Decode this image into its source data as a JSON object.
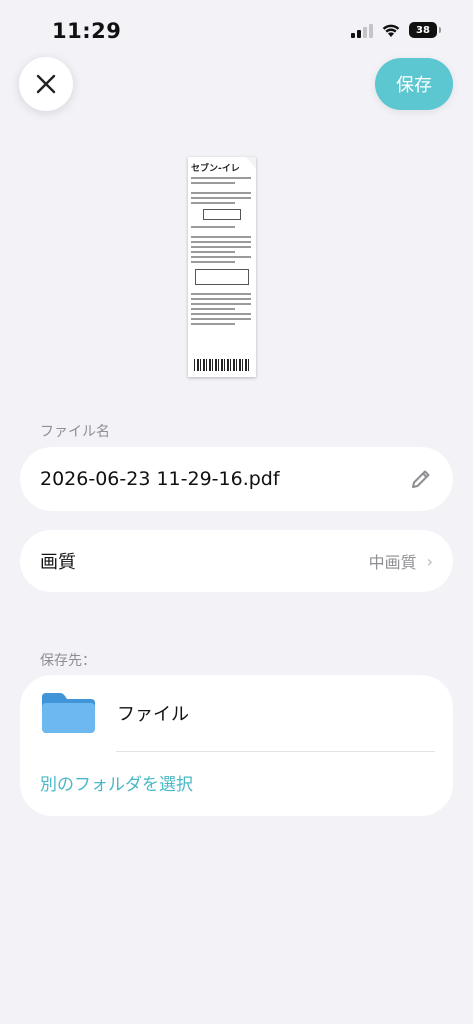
{
  "status_bar": {
    "time": "11:29",
    "battery": "38",
    "signal_bars": 2,
    "icons": [
      "cellular-signal-icon",
      "wifi-icon",
      "battery-icon"
    ]
  },
  "header": {
    "close_icon": "close-icon",
    "save_label": "保存",
    "accent": "#5cc7d0"
  },
  "receipt": {
    "store_name": "セブン-イレ",
    "icon": "document-thumbnail"
  },
  "file_section": {
    "label": "ファイル名",
    "filename": "2026-06-23 11-29-16.pdf",
    "edit_icon": "pencil-icon"
  },
  "quality": {
    "label": "画質",
    "value": "中画質",
    "chevron": "›"
  },
  "destination": {
    "label": "保存先：",
    "folder_name": "ファイル",
    "folder_icon": "folder-icon",
    "choose_other": "別のフォルダを選択",
    "link_color": "#4bb8c6"
  }
}
